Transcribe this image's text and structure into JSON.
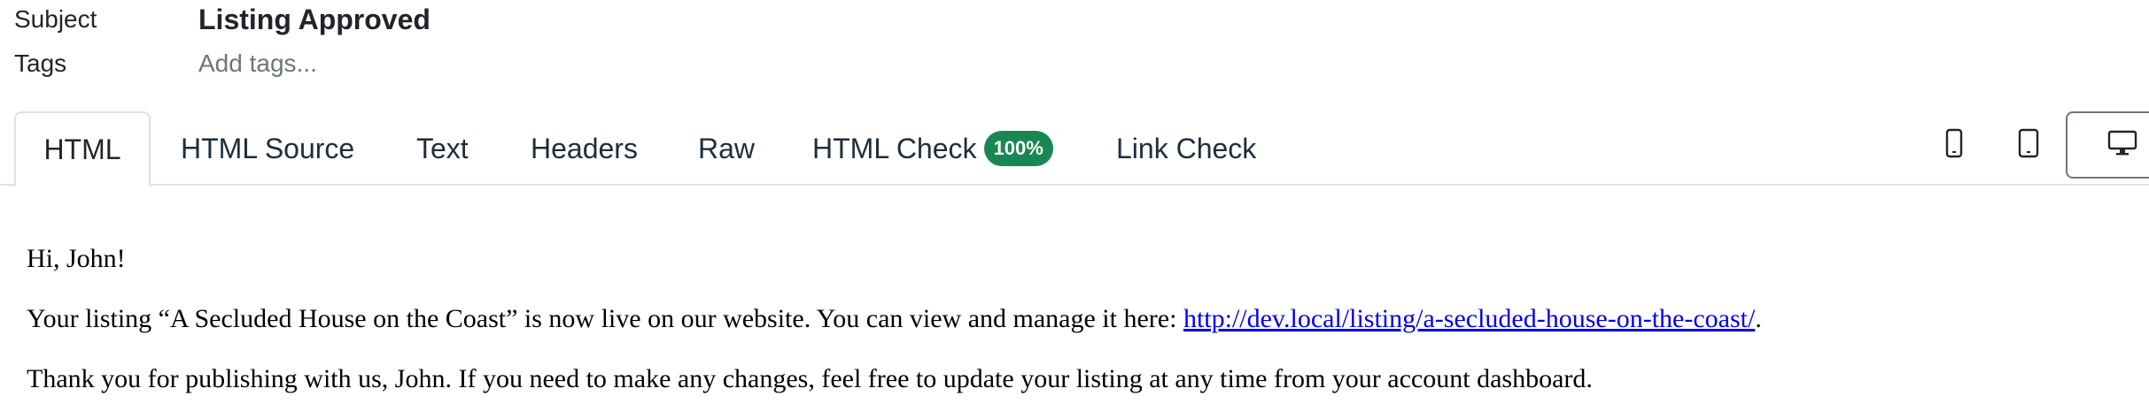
{
  "meta": {
    "subject_label": "Subject",
    "subject_value": "Listing Approved",
    "tags_label": "Tags",
    "tags_placeholder": "Add tags..."
  },
  "tabs": [
    {
      "label": "HTML",
      "active": true
    },
    {
      "label": "HTML Source",
      "active": false
    },
    {
      "label": "Text",
      "active": false
    },
    {
      "label": "Headers",
      "active": false
    },
    {
      "label": "Raw",
      "active": false
    },
    {
      "label": "HTML Check",
      "active": false,
      "badge": "100%"
    },
    {
      "label": "Link Check",
      "active": false
    }
  ],
  "devices": [
    {
      "name": "phone-icon",
      "active": false
    },
    {
      "name": "tablet-icon",
      "active": false
    },
    {
      "name": "desktop-icon",
      "active": true
    }
  ],
  "colors": {
    "badge_bg": "#198754",
    "link": "#0000ee"
  },
  "body": {
    "greeting": "Hi, John!",
    "para1_before": "Your listing “A Secluded House on the Coast” is now live on our website. You can view and manage it here: ",
    "para1_link": "http://dev.local/listing/a-secluded-house-on-the-coast/",
    "para1_after": ".",
    "para2": "Thank you for publishing with us, John. If you need to make any changes, feel free to update your listing at any time from your account dashboard."
  }
}
